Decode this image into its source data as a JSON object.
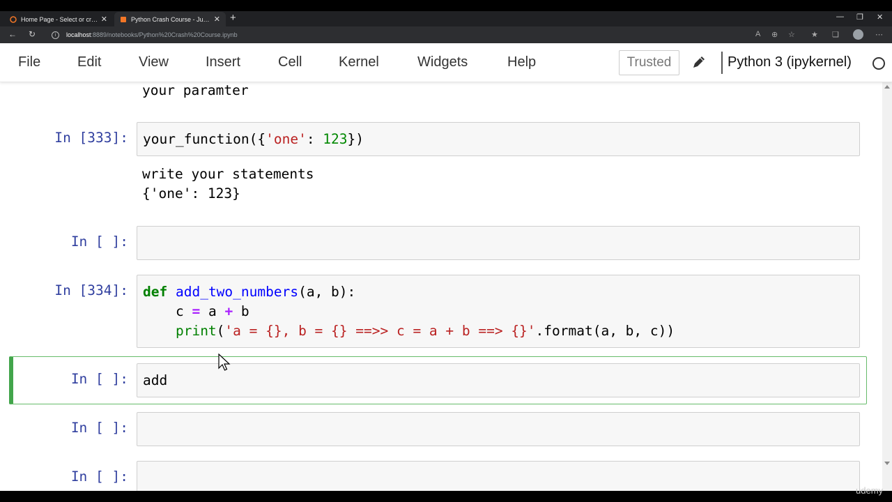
{
  "browser": {
    "tabs": [
      {
        "label": "Home Page - Select or create a notebook",
        "active": false
      },
      {
        "label": "Python Crash Course - Jupyter Notebook",
        "active": true
      }
    ],
    "url_host": "localhost",
    "url_path": ":8889/notebooks/Python%20Crash%20Course.ipynb"
  },
  "menu": {
    "items": [
      "File",
      "Edit",
      "View",
      "Insert",
      "Cell",
      "Kernel",
      "Widgets",
      "Help"
    ],
    "trusted_label": "Trusted",
    "kernel_name": "Python 3 (ipykernel)"
  },
  "notebook": {
    "partial_output": "your paramter",
    "cells": [
      {
        "prompt": "In [333]:",
        "code": "your_function({'one': 123})",
        "output": [
          "write your statements",
          "{'one': 123}"
        ]
      },
      {
        "prompt": "In [ ]:",
        "code": ""
      },
      {
        "prompt": "In [334]:",
        "code": [
          "def add_two_numbers(a, b):",
          "    c = a + b",
          "    print('a = {}, b = {} ==>> c = a + b ==> {}'.format(a, b, c))"
        ]
      },
      {
        "prompt": "In [ ]:",
        "code": "add",
        "selected": true
      },
      {
        "prompt": "In [ ]:",
        "code": ""
      },
      {
        "prompt": "In [ ]:",
        "code": ""
      }
    ]
  },
  "watermark": "udemy",
  "colors": {
    "prompt": "#303f9f",
    "keyword": "#008000",
    "function_name": "#0000ff",
    "string": "#ba2121",
    "number": "#008800",
    "operator": "#aa22ff",
    "selected_border": "#42a54b"
  }
}
